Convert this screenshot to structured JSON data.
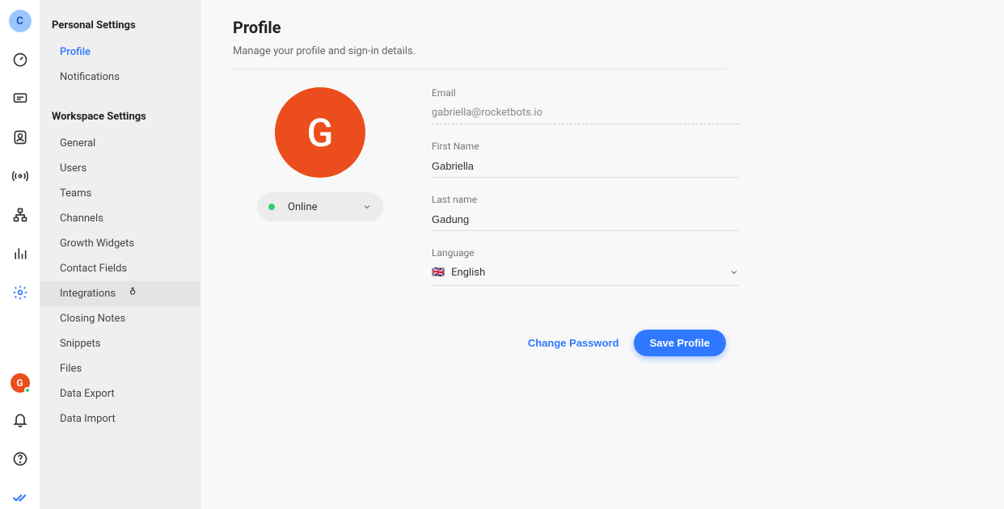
{
  "rail": {
    "workspace_letter": "C",
    "user_letter": "G"
  },
  "sidebar": {
    "personal_title": "Personal Settings",
    "personal_items": [
      {
        "label": "Profile"
      },
      {
        "label": "Notifications"
      }
    ],
    "workspace_title": "Workspace Settings",
    "workspace_items": [
      {
        "label": "General"
      },
      {
        "label": "Users"
      },
      {
        "label": "Teams"
      },
      {
        "label": "Channels"
      },
      {
        "label": "Growth Widgets"
      },
      {
        "label": "Contact Fields"
      },
      {
        "label": "Integrations"
      },
      {
        "label": "Closing Notes"
      },
      {
        "label": "Snippets"
      },
      {
        "label": "Files"
      },
      {
        "label": "Data Export"
      },
      {
        "label": "Data Import"
      }
    ]
  },
  "main": {
    "title": "Profile",
    "subtitle": "Manage your profile and sign-in details.",
    "avatar_letter": "G",
    "status_label": "Online",
    "fields": {
      "email_label": "Email",
      "email_value": "gabriella@rocketbots.io",
      "first_name_label": "First Name",
      "first_name_value": "Gabriella",
      "last_name_label": "Last name",
      "last_name_value": "Gadung",
      "language_label": "Language",
      "language_flag": "🇬🇧",
      "language_value": "English"
    },
    "change_password_label": "Change Password",
    "save_label": "Save Profile"
  }
}
